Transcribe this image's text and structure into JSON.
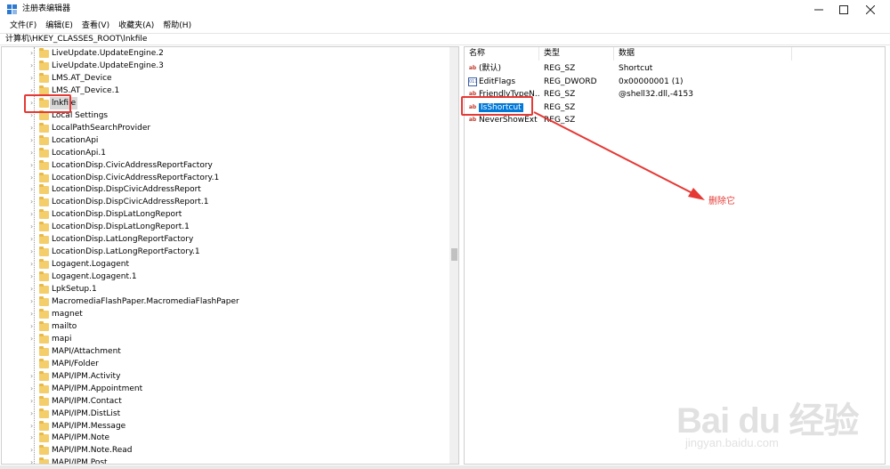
{
  "window": {
    "title": "注册表编辑器",
    "minimize_glyph": "—",
    "maximize_glyph": "☐",
    "close_glyph": "✕",
    "icon": "registry-editor-icon"
  },
  "menu": [
    "文件(F)",
    "编辑(E)",
    "查看(V)",
    "收藏夹(A)",
    "帮助(H)"
  ],
  "address": "计算机\\HKEY_CLASSES_ROOT\\lnkfile",
  "tree": {
    "selected": "lnkfile",
    "items": [
      {
        "label": "LiveUpdate.UpdateEngine.2",
        "expandable": true
      },
      {
        "label": "LiveUpdate.UpdateEngine.3",
        "expandable": true
      },
      {
        "label": "LMS.AT_Device",
        "expandable": true
      },
      {
        "label": "LMS.AT_Device.1",
        "expandable": true
      },
      {
        "label": "lnkfile",
        "expandable": true
      },
      {
        "label": "Local Settings",
        "expandable": true
      },
      {
        "label": "LocalPathSearchProvider",
        "expandable": true
      },
      {
        "label": "LocationApi",
        "expandable": true
      },
      {
        "label": "LocationApi.1",
        "expandable": true
      },
      {
        "label": "LocationDisp.CivicAddressReportFactory",
        "expandable": true
      },
      {
        "label": "LocationDisp.CivicAddressReportFactory.1",
        "expandable": true
      },
      {
        "label": "LocationDisp.DispCivicAddressReport",
        "expandable": true
      },
      {
        "label": "LocationDisp.DispCivicAddressReport.1",
        "expandable": true
      },
      {
        "label": "LocationDisp.DispLatLongReport",
        "expandable": true
      },
      {
        "label": "LocationDisp.DispLatLongReport.1",
        "expandable": true
      },
      {
        "label": "LocationDisp.LatLongReportFactory",
        "expandable": true
      },
      {
        "label": "LocationDisp.LatLongReportFactory.1",
        "expandable": true
      },
      {
        "label": "Logagent.Logagent",
        "expandable": true
      },
      {
        "label": "Logagent.Logagent.1",
        "expandable": true
      },
      {
        "label": "LpkSetup.1",
        "expandable": true
      },
      {
        "label": "MacromediaFlashPaper.MacromediaFlashPaper",
        "expandable": true
      },
      {
        "label": "magnet",
        "expandable": true
      },
      {
        "label": "mailto",
        "expandable": true
      },
      {
        "label": "mapi",
        "expandable": true
      },
      {
        "label": "MAPI/Attachment",
        "expandable": false
      },
      {
        "label": "MAPI/Folder",
        "expandable": false
      },
      {
        "label": "MAPI/IPM.Activity",
        "expandable": true
      },
      {
        "label": "MAPI/IPM.Appointment",
        "expandable": true
      },
      {
        "label": "MAPI/IPM.Contact",
        "expandable": true
      },
      {
        "label": "MAPI/IPM.DistList",
        "expandable": true
      },
      {
        "label": "MAPI/IPM.Message",
        "expandable": true
      },
      {
        "label": "MAPI/IPM.Note",
        "expandable": true
      },
      {
        "label": "MAPI/IPM.Note.Read",
        "expandable": true
      },
      {
        "label": "MAPI/IPM.Post",
        "expandable": true
      }
    ]
  },
  "values": {
    "headers": {
      "name": "名称",
      "type": "类型",
      "data": "数据"
    },
    "rows": [
      {
        "icon": "string-value-icon",
        "name": "(默认)",
        "type": "REG_SZ",
        "data": "Shortcut"
      },
      {
        "icon": "binary-value-icon",
        "name": "EditFlags",
        "type": "REG_DWORD",
        "data": "0x00000001 (1)"
      },
      {
        "icon": "string-value-icon",
        "name": "FriendlyTypeN...",
        "type": "REG_SZ",
        "data": "@shell32.dll,-4153"
      },
      {
        "icon": "string-value-icon",
        "name": "IsShortcut",
        "type": "REG_SZ",
        "data": "",
        "selected": true
      },
      {
        "icon": "string-value-icon",
        "name": "NeverShowExt",
        "type": "REG_SZ",
        "data": ""
      }
    ]
  },
  "annotation": {
    "text": "删除它",
    "color": "#e53935"
  },
  "watermark": {
    "brand": "Bai du 经验",
    "url": "jingyan.baidu.com"
  },
  "colors": {
    "selection": "#0078d7",
    "folder": "#f4ce6a",
    "highlight": "#e53935"
  }
}
